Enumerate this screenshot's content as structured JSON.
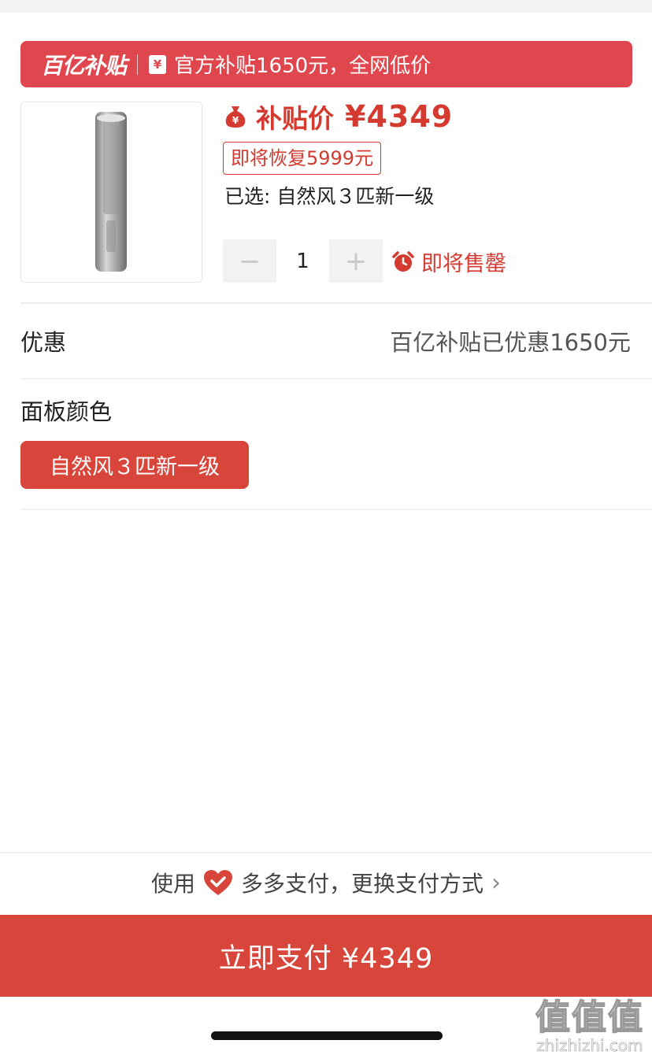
{
  "banner": {
    "brand": "百亿补贴",
    "icon": "yen-receipt-icon",
    "icon_glyph": "¥",
    "text": "官方补贴1650元，全网低价",
    "color": "#e0464d"
  },
  "product": {
    "image_icon": "tower-air-conditioner-image",
    "price_label": "补贴价",
    "price": "¥4349",
    "restore_tag": "即将恢复5999元",
    "selected_text": "已选: 自然风３匹新一级",
    "quantity": "1",
    "minus_label": "−",
    "plus_label": "+",
    "soldout_text": "即将售罄",
    "accent_color": "#d43a30"
  },
  "discount": {
    "label": "优惠",
    "value": "百亿补贴已优惠1650元"
  },
  "panel_color": {
    "label": "面板颜色",
    "option": "自然风３匹新一级"
  },
  "payment": {
    "prefix": "使用",
    "method": "多多支付，更换支付方式",
    "icon": "heart-check-icon",
    "chevron": "›",
    "button": "立即支付 ¥4349"
  },
  "watermark": {
    "big": "值值值",
    "small": "zhizhizhi.com"
  }
}
